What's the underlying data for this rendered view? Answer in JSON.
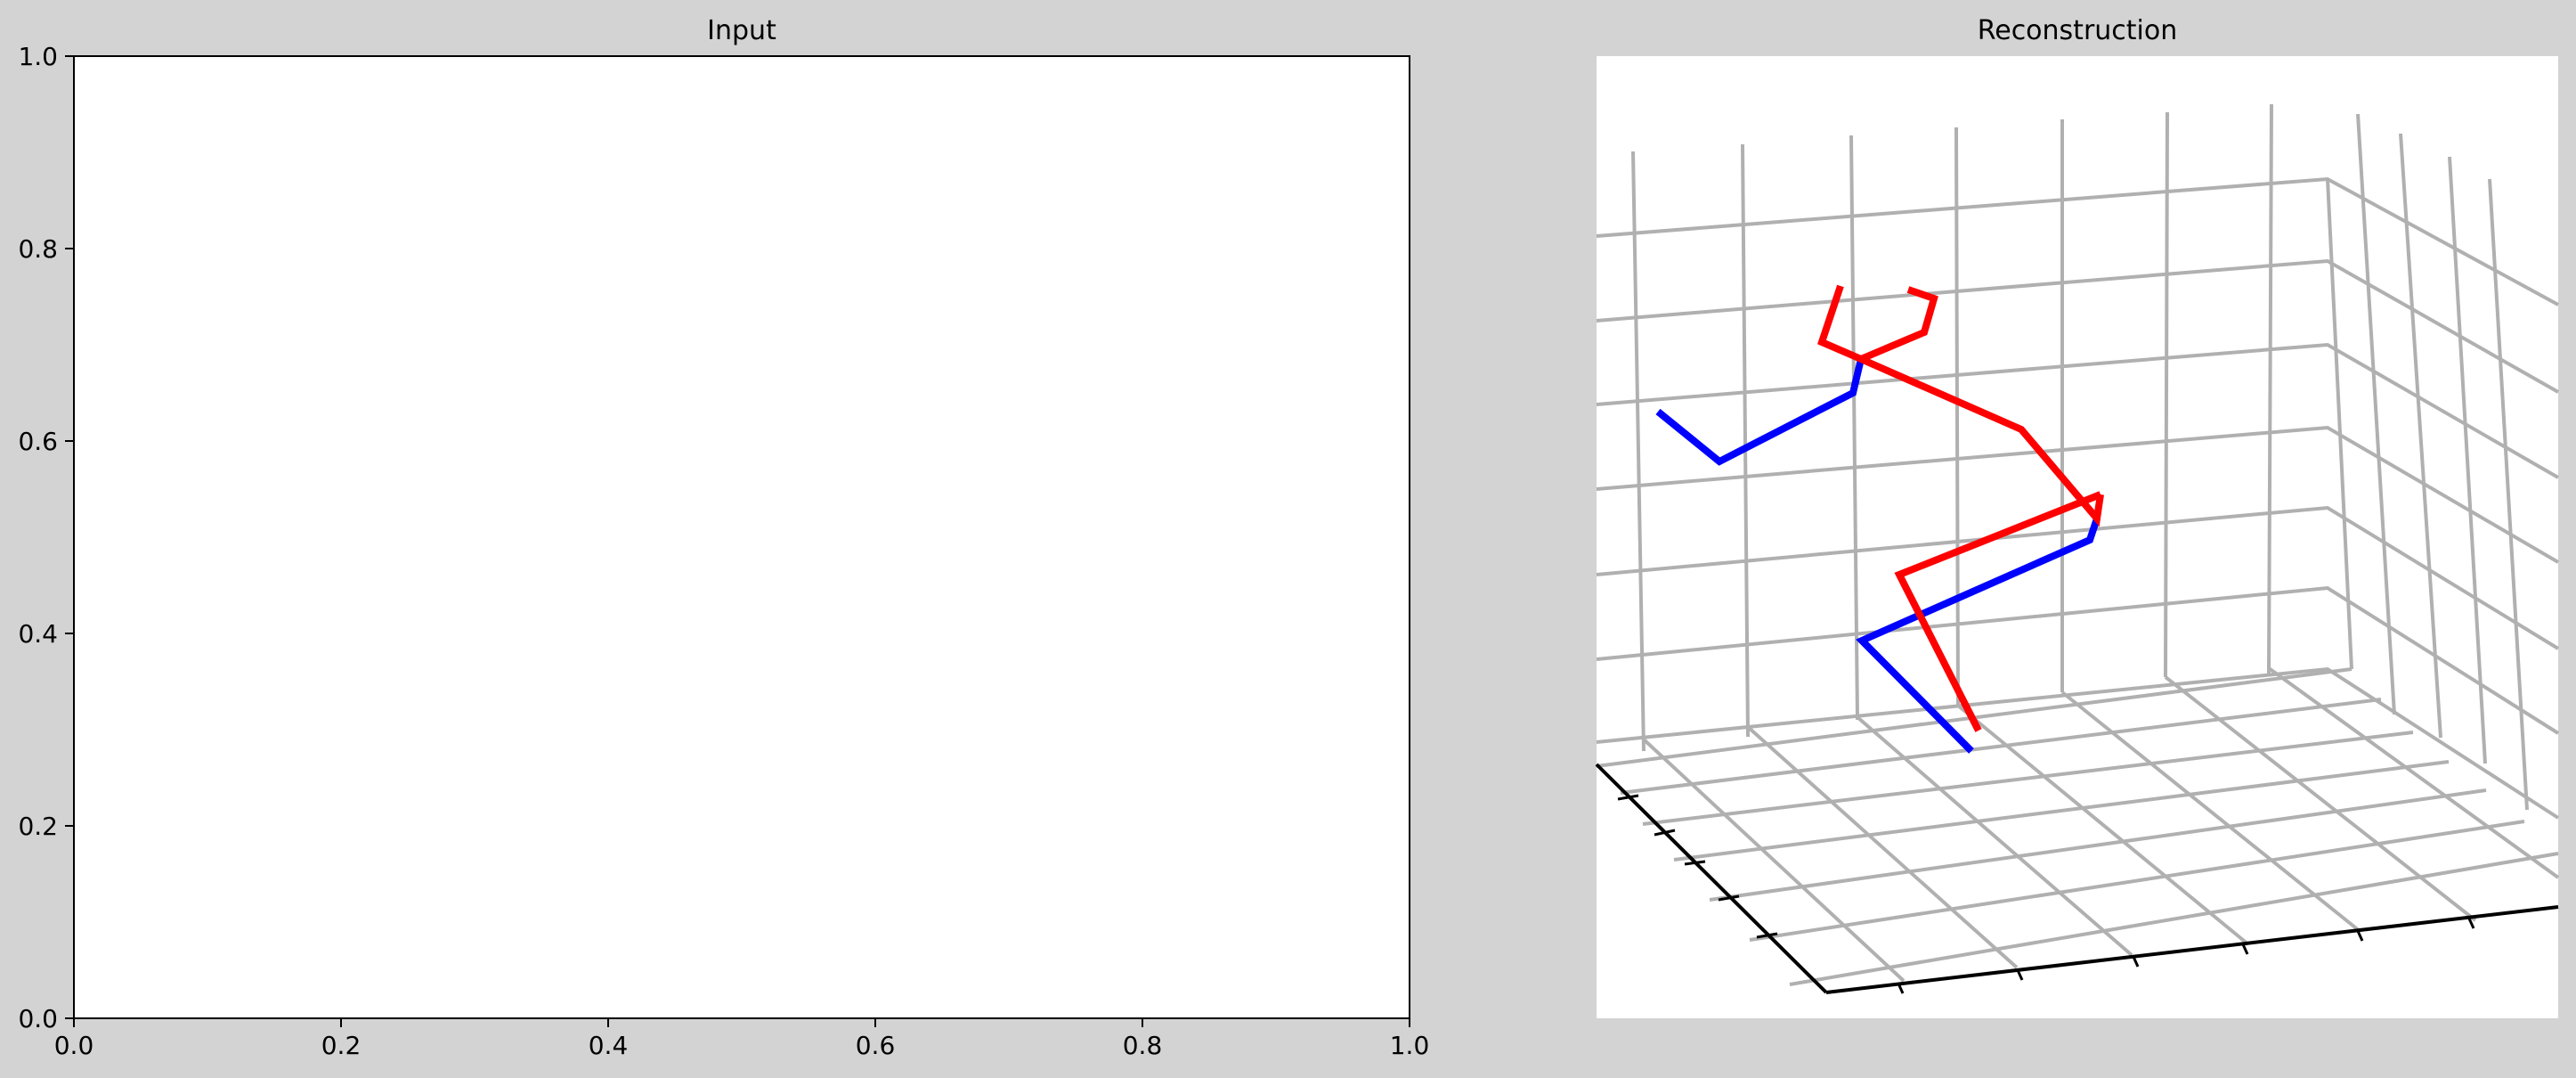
{
  "colors": {
    "figure_background": "#d3d3d3",
    "axes_background": "#ffffff",
    "grid": "#b0b0b0",
    "axis_line": "#000000",
    "series_blue": "#0000ff",
    "series_red": "#ff0000"
  },
  "chart_data": [
    {
      "type": "line",
      "title": "Input",
      "xlabel": "",
      "ylabel": "",
      "xlim": [
        0,
        1
      ],
      "ylim": [
        0,
        1
      ],
      "xticks": [
        "0.0",
        "0.2",
        "0.4",
        "0.6",
        "0.8",
        "1.0"
      ],
      "yticks": [
        "0.0",
        "0.2",
        "0.4",
        "0.6",
        "0.8",
        "1.0"
      ],
      "series": [],
      "grid": false
    },
    {
      "type": "line3d",
      "title": "Reconstruction",
      "grid": true,
      "tick_labels_visible": false,
      "series": [
        {
          "color": "blue",
          "segments": [
            "upper-left limb",
            "lower limb chain"
          ]
        },
        {
          "color": "red",
          "segments": [
            "upper-right limb",
            "lower limb chain"
          ]
        }
      ]
    }
  ]
}
